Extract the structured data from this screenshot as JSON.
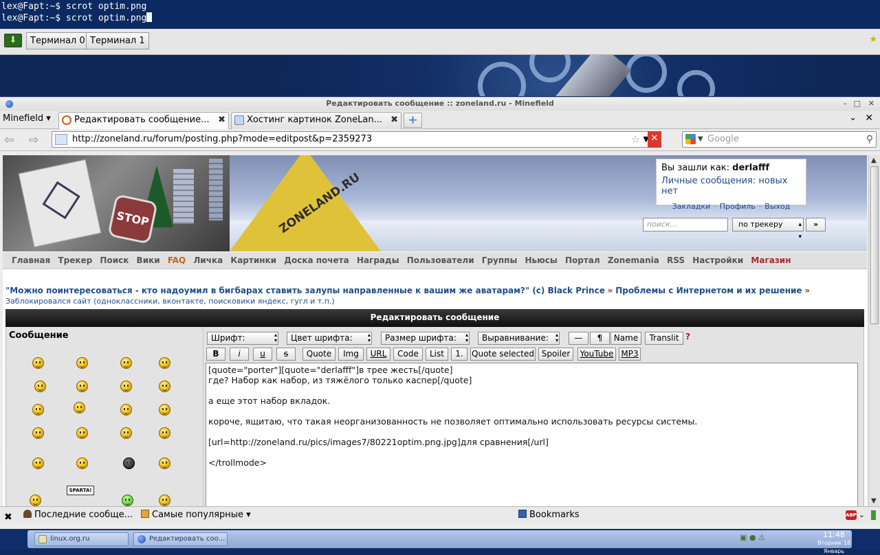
{
  "terminal": {
    "lines": [
      "lex@Fapt:~$ scrot optim.png",
      "lex@Fapt:~$ scrot optim.png"
    ]
  },
  "terminal_tabs": {
    "tabs": [
      "Терминал 0",
      "Терминал 1"
    ]
  },
  "browser": {
    "window_title": "Редактировать сообщение :: zoneland.ru - Minefield",
    "menu_label": "Minefield",
    "tabs": [
      {
        "label": "Редактировать сообщение...",
        "active": true
      },
      {
        "label": "Хостинг картинок ZoneLan...",
        "active": false
      }
    ],
    "url": "http://zoneland.ru/forum/posting.php?mode=editpost&p=2359273",
    "search_placeholder": "Google"
  },
  "site": {
    "user_prefix": "Вы зашли как:",
    "username": "derlafff",
    "pm_text": "Личные сообщения: новых нет",
    "user_links": [
      "Закладки",
      "Профиль",
      "Выход"
    ],
    "search_placeholder": "поиск...",
    "search_scope": "по трекеру",
    "search_go": "»",
    "banner_text": "ZONELAND.RU",
    "stop_text": "STOP",
    "menu": [
      "Главная",
      "Трекер",
      "Поиск",
      "Вики",
      "FAQ",
      "Личка",
      "Картинки",
      "Доска почета",
      "Награды",
      "Пользователи",
      "Группы",
      "Ньюсы",
      "Портал",
      "Zonemania",
      "RSS",
      "Настройки",
      "Магазин"
    ],
    "breadcrumb": {
      "quote": "\"Можно поинтересоваться - кто надоумил в бигбарах ставить залупы направленные к вашим же аватарам?\" (c) Black Prince",
      "sep": "»",
      "section": "Проблемы с Интернетом и их решение",
      "subsection": "Заблокировался сайт (одноклассники, вконтакте, поисковики яндекс, гугл и т.п.)"
    },
    "form_title": "Редактировать сообщение",
    "message_label": "Сообщение",
    "sparta_label": "SPARTA!",
    "toolbar_row1": {
      "font": "Шрифт:",
      "color": "Цвет шрифта:",
      "size": "Размер шрифта:",
      "align": "Выравнивание:",
      "dash": "—",
      "para": "¶",
      "name": "Name",
      "translit": "Translit",
      "help": "?"
    },
    "toolbar_row2": [
      "B",
      "i",
      "u",
      "s",
      "Quote",
      "Img",
      "URL",
      "Code",
      "List",
      "1.",
      "Quote selected",
      "Spoiler",
      "YouTube",
      "MP3"
    ],
    "message_text": "[quote=\"porter\"][quote=\"derlafff\"]в трее жесть[/quote]\nгде? Набор как набор, из тяжёлого только каспер[/quote]\n\nа еще этот набор вкладок.\n\nкороче, ящитаю, что такая неорганизованность не позволяет оптимально использовать ресурсы системы.\n\n[url=http://zoneland.ru/pics/images7/80221optim.png.jpg]для сравнения[/url]\n\n</trollmode>"
  },
  "bookmarks_bar": {
    "recent": "Последние сообще...",
    "popular": "Самые популярные",
    "bookmarks": "Bookmarks",
    "abp": "ABP"
  },
  "taskbar": {
    "tasks": [
      "linux.org.ru",
      "Редактировать соо..."
    ],
    "time": "11:48",
    "date": "Вторник 18 Январь"
  }
}
